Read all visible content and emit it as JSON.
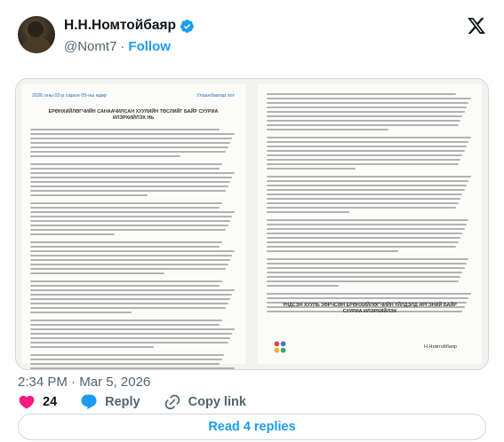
{
  "user": {
    "display_name": "Н.Н.Номтойбаяр",
    "handle": "@Nomt7",
    "follow_label": "Follow",
    "verified": true
  },
  "document": {
    "left_page": {
      "date_header": "2026 оны 03-р сарын 05-ны өдөр",
      "place_header": "Улаанбаатар хот",
      "title": "ЕРӨНХИЙЛӨГЧИЙН САНААЧИЛСАН ХУУЛИЙН ТӨСЛИЙГ БАЙР СУУРИА ИЛЭРХИЙЛЭХ НЬ"
    },
    "right_page": {
      "closing": "ҮНДСЭН ХУУЛЬ ЗӨРЧСӨН ЕРӨНХИЙЛӨГЧИЙН ҮЙЛДЭЛД ИРГЭНИЙ БАЙР СУУРИА ИЛЭРХИЙЛЭХ",
      "signature": "Н.Номтойбаяр"
    }
  },
  "meta": {
    "time": "2:34 PM",
    "separator": "·",
    "date": "Mar 5, 2026"
  },
  "actions": {
    "likes_count": "24",
    "reply_label": "Reply",
    "copy_label": "Copy link"
  },
  "read_replies_label": "Read 4 replies",
  "colors": {
    "like": "#f91880",
    "link": "#1d9bf0",
    "verified": "#1d9bf0"
  }
}
